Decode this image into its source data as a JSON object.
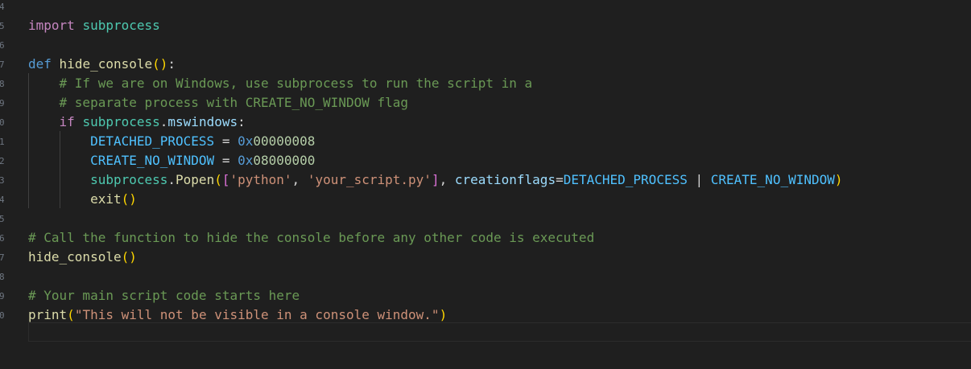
{
  "editor": {
    "line_numbers": [
      "4",
      "5",
      "6",
      "7",
      "8",
      "9",
      "0",
      "1",
      "2",
      "3",
      "4",
      "5",
      "6",
      "7",
      "8",
      "9",
      "0"
    ],
    "lines": [
      [
        {
          "t": "import",
          "c": "kw"
        },
        {
          "t": " ",
          "c": "op"
        },
        {
          "t": "subprocess",
          "c": "mod"
        }
      ],
      [],
      [
        {
          "t": "def",
          "c": "def"
        },
        {
          "t": " ",
          "c": "op"
        },
        {
          "t": "hide_console",
          "c": "fn"
        },
        {
          "t": "()",
          "c": "p1"
        },
        {
          "t": ":",
          "c": "op"
        }
      ],
      [
        {
          "t": "    # If we are on Windows, use subprocess to run the script in a",
          "c": "cm"
        }
      ],
      [
        {
          "t": "    # separate process with CREATE_NO_WINDOW flag",
          "c": "cm"
        }
      ],
      [
        {
          "t": "    ",
          "c": "op"
        },
        {
          "t": "if",
          "c": "kw"
        },
        {
          "t": " ",
          "c": "op"
        },
        {
          "t": "subprocess",
          "c": "mod"
        },
        {
          "t": ".",
          "c": "op"
        },
        {
          "t": "mswindows",
          "c": "var"
        },
        {
          "t": ":",
          "c": "op"
        }
      ],
      [
        {
          "t": "        ",
          "c": "op"
        },
        {
          "t": "DETACHED_PROCESS",
          "c": "const"
        },
        {
          "t": " = ",
          "c": "op"
        },
        {
          "t": "0x",
          "c": "def"
        },
        {
          "t": "00000008",
          "c": "num"
        }
      ],
      [
        {
          "t": "        ",
          "c": "op"
        },
        {
          "t": "CREATE_NO_WINDOW",
          "c": "const"
        },
        {
          "t": " = ",
          "c": "op"
        },
        {
          "t": "0x",
          "c": "def"
        },
        {
          "t": "08000000",
          "c": "num"
        }
      ],
      [
        {
          "t": "        ",
          "c": "op"
        },
        {
          "t": "subprocess",
          "c": "mod"
        },
        {
          "t": ".",
          "c": "op"
        },
        {
          "t": "Popen",
          "c": "fn"
        },
        {
          "t": "(",
          "c": "p1"
        },
        {
          "t": "[",
          "c": "p2"
        },
        {
          "t": "'python'",
          "c": "str"
        },
        {
          "t": ", ",
          "c": "op"
        },
        {
          "t": "'your_script.py'",
          "c": "str"
        },
        {
          "t": "]",
          "c": "p2"
        },
        {
          "t": ", ",
          "c": "op"
        },
        {
          "t": "creationflags",
          "c": "var"
        },
        {
          "t": "=",
          "c": "op"
        },
        {
          "t": "DETACHED_PROCESS",
          "c": "const"
        },
        {
          "t": " | ",
          "c": "op"
        },
        {
          "t": "CREATE_NO_WINDOW",
          "c": "const"
        },
        {
          "t": ")",
          "c": "p1"
        }
      ],
      [
        {
          "t": "        ",
          "c": "op"
        },
        {
          "t": "exit",
          "c": "fn"
        },
        {
          "t": "()",
          "c": "p1"
        }
      ],
      [],
      [
        {
          "t": "# Call the function to hide the console before any other code is executed",
          "c": "cm"
        }
      ],
      [
        {
          "t": "hide_console",
          "c": "fn"
        },
        {
          "t": "()",
          "c": "p1"
        }
      ],
      [],
      [
        {
          "t": "# Your main script code starts here",
          "c": "cm"
        }
      ],
      [
        {
          "t": "print",
          "c": "fn"
        },
        {
          "t": "(",
          "c": "p1"
        },
        {
          "t": "\"This will not be visible in a console window.\"",
          "c": "str"
        },
        {
          "t": ")",
          "c": "p1"
        }
      ],
      []
    ]
  }
}
